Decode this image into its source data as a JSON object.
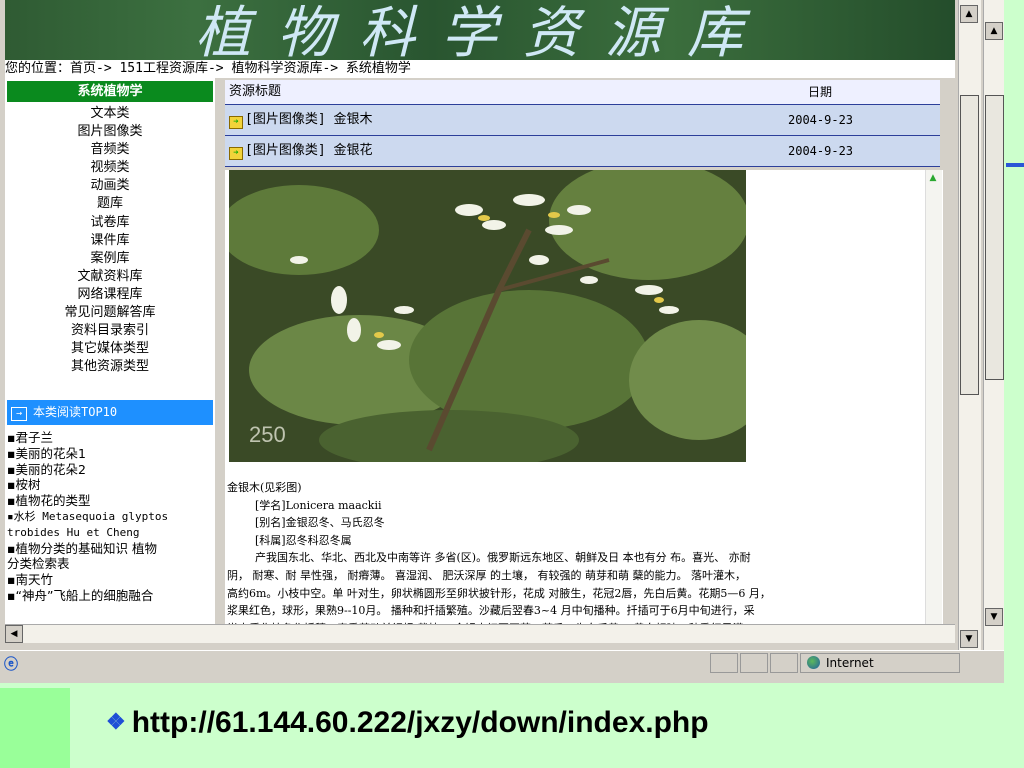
{
  "banner": {
    "title": "植物科学资源库"
  },
  "breadcrumb": "您的位置：首页-> 151工程资源库-> 植物科学资源库-> 系统植物学",
  "sidebar": {
    "heading": "系统植物学",
    "categories": [
      "文本类",
      "图片图像类",
      "音频类",
      "视频类",
      "动画类",
      "题库",
      "试卷库",
      "课件库",
      "案例库",
      "文献资料库",
      "网络课程库",
      "常见问题解答库",
      "资料目录索引",
      "其它媒体类型",
      "其他资源类型"
    ],
    "top10_heading": "本类阅读TOP10",
    "top10": [
      "▪君子兰",
      "▪美丽的花朵1",
      "▪美丽的花朵2",
      "▪桉树",
      "▪植物花的类型",
      "▪水杉 Metasequoia glyptos",
      "trobides Hu et Cheng",
      "▪植物分类的基础知识 植物",
      "分类检索表",
      "▪南天竹",
      "▪“神舟”飞船上的细胞融合"
    ]
  },
  "table": {
    "col_title": "资源标题",
    "col_date": "日期",
    "rows": [
      {
        "title": "[图片图像类] 金银木",
        "date": "2004-9-23"
      },
      {
        "title": "[图片图像类] 金银花",
        "date": "2004-9-23"
      }
    ]
  },
  "document": {
    "photo_number": "250",
    "lines": [
      "金银木(见彩图)",
      "[学名]Lonicera maackii",
      "[别名]金银忍冬、马氏忍冬",
      "[科属]忍冬科忍冬属",
      "产我国东北、华北、西北及中南等许 多省(区)。俄罗斯远东地区、朝鲜及日 本也有分 布。喜光、 亦耐",
      "阴， 耐寒、耐 旱性强， 耐瘠薄。 喜湿润、 肥沃深厚 的土壤， 有较强的 萌芽和萌 蘖的能力。 落叶灌木，",
      "高约6m。小枝中空。单 叶对生，卵状椭圆形至卵状披针形，花成 对腋生，花冠2唇，先白后黄。花期5—6 月，",
      "浆果红色，球形，果熟9--10月。 播种和扦插繁殖。沙藏后翌春3~4 月中旬播种。扦插可于6月中旬进行，采",
      "半木质化枝条作插穗。春季萌动前裸根 栽植。 金银木初夏开花，芳香，先白后黄， 黄白相映，秋季红果满"
    ]
  },
  "status": {
    "zone": "Internet"
  },
  "slide_url": "http://61.144.60.222/jxzy/down/index.php",
  "colors": {
    "sidebar_head": "#0a8a1e",
    "top10_head": "#1e90ff",
    "table_row": "#ccd9ef",
    "slide_bg": "#ccffcc"
  }
}
